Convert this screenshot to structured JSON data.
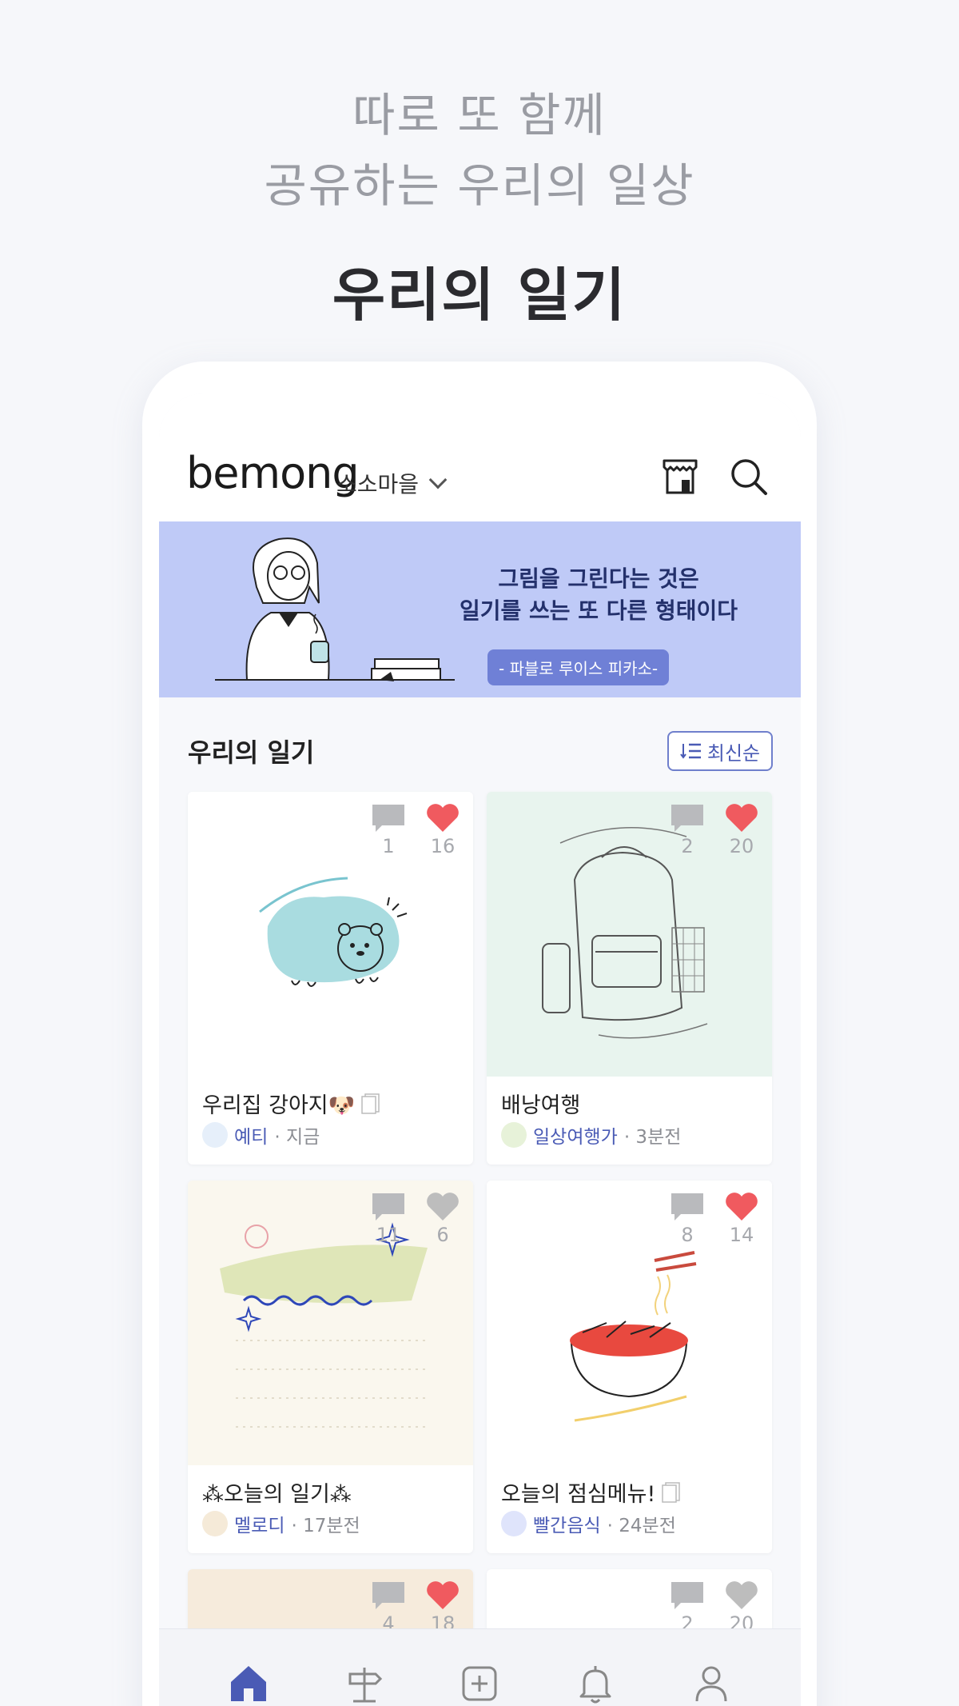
{
  "promo": {
    "line1": "따로 또 함께",
    "line2": "공유하는 우리의 일상",
    "title": "우리의 일기"
  },
  "appbar": {
    "logo": "bemong",
    "village": "소소마을",
    "icons": [
      "store-icon",
      "search-icon"
    ]
  },
  "banner": {
    "quote_line1": "그림을 그린다는 것은",
    "quote_line2": "일기를 쓰는 또 다른 형태이다",
    "author": "- 파블로 루이스 피카소-"
  },
  "section": {
    "title": "우리의 일기",
    "sort_label": "최신순"
  },
  "cards": [
    {
      "title": "우리집 강아지🐶",
      "author": "예티",
      "time": "· 지금",
      "comments": "1",
      "likes": "16",
      "liked": true,
      "bg": "#ffffff"
    },
    {
      "title": "배낭여행",
      "author": "일상여행가",
      "time": "· 3분전",
      "comments": "2",
      "likes": "20",
      "liked": true,
      "bg": "#e8f4ee"
    },
    {
      "title": "⁂오늘의 일기⁂",
      "author": "멜로디",
      "time": "· 17분전",
      "comments": "11",
      "likes": "6",
      "liked": false,
      "bg": "#faf7ee"
    },
    {
      "title": "오늘의 점심메뉴!",
      "author": "빨간음식",
      "time": "· 24분전",
      "comments": "8",
      "likes": "14",
      "liked": true,
      "bg": "#ffffff"
    },
    {
      "title": "",
      "author": "",
      "time": "",
      "comments": "4",
      "likes": "18",
      "liked": true,
      "bg": "#f6ebdc"
    },
    {
      "title": "",
      "author": "",
      "time": "",
      "comments": "2",
      "likes": "20",
      "liked": false,
      "bg": "#ffffff"
    }
  ],
  "tabs": [
    "home-icon",
    "signpost-icon",
    "add-icon",
    "bell-icon",
    "profile-icon"
  ],
  "colors": {
    "accent": "#4a5bb5",
    "banner": "#bfcaf7",
    "like_active": "#f05a5f",
    "like_inactive": "#bdbdbd"
  }
}
